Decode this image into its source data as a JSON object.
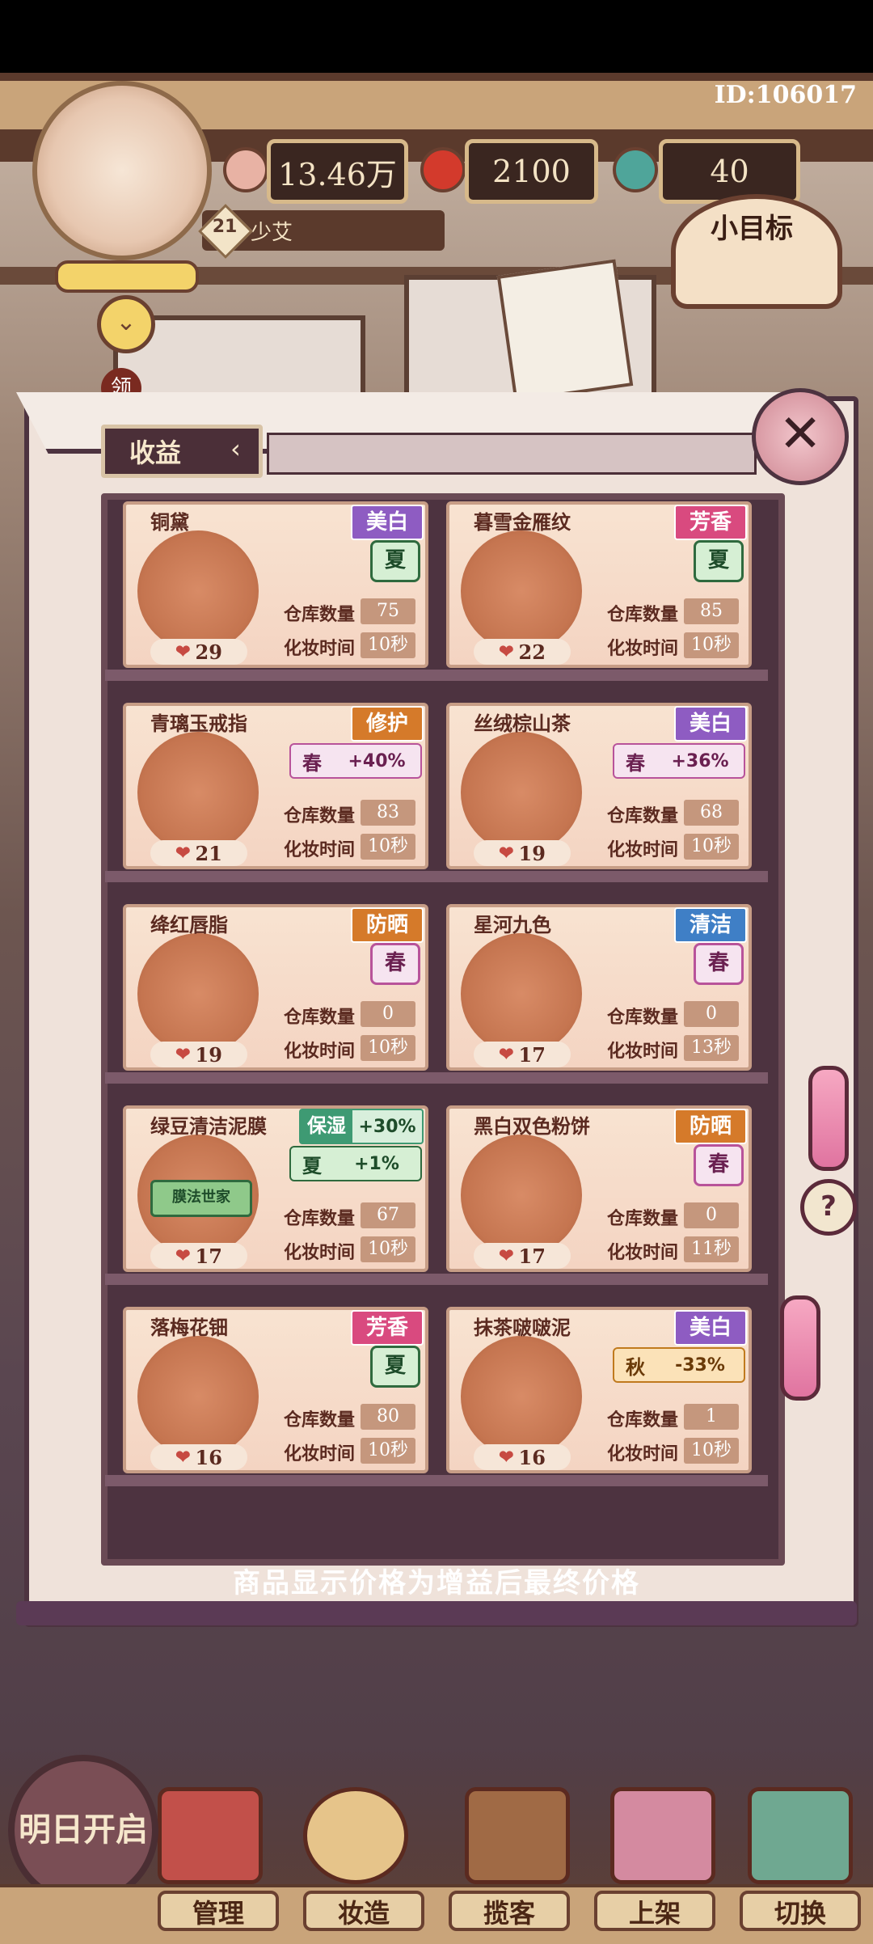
{
  "header": {
    "id_label": "ID:106017",
    "resources": [
      {
        "value": "13.46万",
        "icon": "heart-coin-icon"
      },
      {
        "value": "2100",
        "icon": "apple-icon"
      },
      {
        "value": "40",
        "icon": "jade-icon"
      }
    ],
    "level": "21",
    "player_name": "少艾",
    "goal_label": "小目标",
    "claim_label": "领"
  },
  "panel": {
    "tab_title": "收益",
    "footer_note": "商品显示价格为增益后最终价格"
  },
  "labels": {
    "stock": "仓库数量",
    "time": "化妆时间"
  },
  "items": [
    {
      "name": "铜黛",
      "tag": "美白",
      "tag_color": "#8e5cc2",
      "season": "夏",
      "bonus": "",
      "stock": "75",
      "time": "10秒",
      "price": "29",
      "icon": "powder-jar-icon"
    },
    {
      "name": "暮雪金雁纹",
      "tag": "芳香",
      "tag_color": "#d94a7f",
      "season": "夏",
      "bonus": "",
      "stock": "85",
      "time": "10秒",
      "price": "22",
      "icon": "feather-ornament-icon"
    },
    {
      "name": "青璃玉戒指",
      "tag": "修护",
      "tag_color": "#d57a2a",
      "season": "春",
      "bonus": "+40%",
      "stock": "83",
      "time": "10秒",
      "price": "21",
      "icon": "jade-ring-icon"
    },
    {
      "name": "丝绒棕山茶",
      "tag": "美白",
      "tag_color": "#8e5cc2",
      "season": "春",
      "bonus": "+36%",
      "stock": "68",
      "time": "10秒",
      "price": "19",
      "icon": "lipstick-icon"
    },
    {
      "name": "绛红唇脂",
      "tag": "防晒",
      "tag_color": "#d57a2a",
      "season": "春",
      "bonus": "",
      "stock": "0",
      "time": "10秒",
      "price": "19",
      "icon": "lip-balm-icon"
    },
    {
      "name": "星河九色",
      "tag": "清洁",
      "tag_color": "#3f7fc6",
      "season": "春",
      "bonus": "",
      "stock": "0",
      "time": "13秒",
      "price": "17",
      "icon": "compact-icon"
    },
    {
      "name": "绿豆清洁泥膜",
      "tag": "保湿",
      "tag_color": "#3e9a73",
      "tag_bonus": "+30%",
      "season": "夏",
      "bonus": "+1%",
      "stock": "67",
      "time": "10秒",
      "price": "17",
      "icon": "mud-mask-icon",
      "jar_label": "膜法世家"
    },
    {
      "name": "黑白双色粉饼",
      "tag": "防晒",
      "tag_color": "#d57a2a",
      "season": "春",
      "bonus": "",
      "stock": "0",
      "time": "11秒",
      "price": "17",
      "icon": "yin-yang-powder-icon"
    },
    {
      "name": "落梅花钿",
      "tag": "芳香",
      "tag_color": "#d94a7f",
      "season": "夏",
      "bonus": "",
      "stock": "80",
      "time": "10秒",
      "price": "16",
      "icon": "plum-blossom-icon"
    },
    {
      "name": "抹茶啵啵泥",
      "tag": "美白",
      "tag_color": "#8e5cc2",
      "season": "秋",
      "bonus": "-33%",
      "stock": "1",
      "time": "10秒",
      "price": "16",
      "icon": "matcha-mask-icon"
    }
  ],
  "bottom_nav": {
    "tomorrow": "明日开启",
    "buttons": [
      "管理",
      "妆造",
      "揽客",
      "上架",
      "切换"
    ]
  },
  "help_label": "?"
}
